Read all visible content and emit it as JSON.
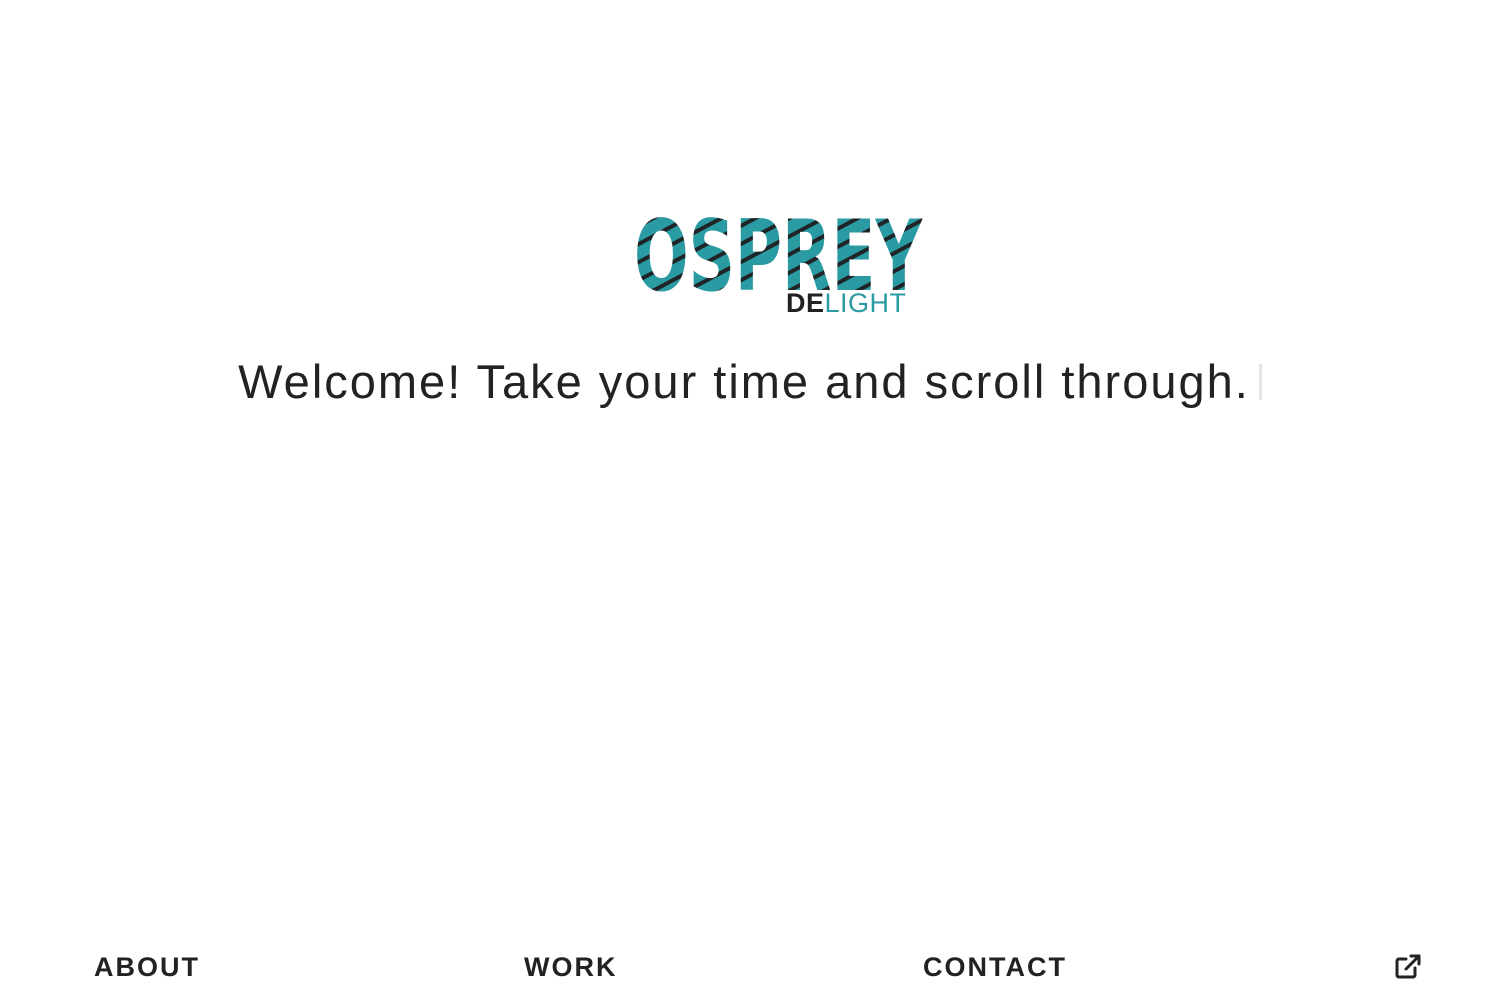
{
  "logo": {
    "main": "OSPREY",
    "sub_bold": "DE",
    "sub_light": "LIGHT"
  },
  "colors": {
    "accent": "#2a9aa3",
    "text": "#222222",
    "background": "#ffffff"
  },
  "welcome_text": "Welcome! Take your time and scroll through.",
  "nav": {
    "about": "ABOUT",
    "work": "WORK",
    "contact": "CONTACT"
  },
  "icons": {
    "external": "external-link-icon"
  }
}
